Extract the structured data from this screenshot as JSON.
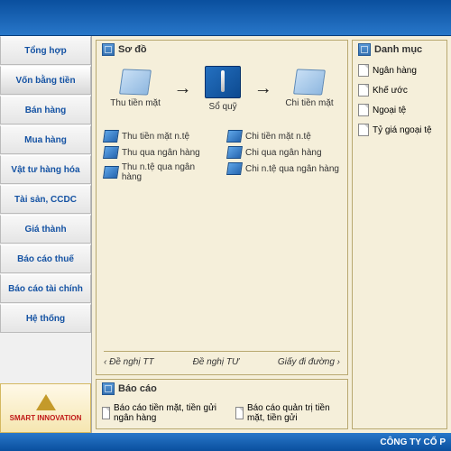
{
  "sidebar": {
    "items": [
      {
        "label": "Tổng hợp"
      },
      {
        "label": "Vốn bằng tiền"
      },
      {
        "label": "Bán hàng"
      },
      {
        "label": "Mua hàng"
      },
      {
        "label": "Vật tư hàng hóa"
      },
      {
        "label": "Tài sản, CCDC"
      },
      {
        "label": "Giá thành"
      },
      {
        "label": "Báo cáo thuế"
      },
      {
        "label": "Báo cáo tài chính"
      },
      {
        "label": "Hệ thống"
      }
    ],
    "active_index": 1,
    "brand": "SMART INNOVATION"
  },
  "schema": {
    "title": "Sơ đồ",
    "flow": {
      "left": "Thu tiền mặt",
      "center": "Sổ quỹ",
      "right": "Chi tiền mặt"
    },
    "actions_left": [
      "Thu tiền mặt n.tệ",
      "Thu qua ngân hàng",
      "Thu n.tệ qua ngân hàng"
    ],
    "actions_right": [
      "Chi tiền mặt n.tệ",
      "Chi qua ngân hàng",
      "Chi n.tệ qua ngân hàng"
    ],
    "footer": {
      "left": "‹ Đề nghị TT",
      "center": "Đề nghị TƯ",
      "right": "Giấy đi đường ›"
    }
  },
  "report": {
    "title": "Báo cáo",
    "items": [
      "Báo cáo tiền mặt, tiền gửi ngân hàng",
      "Báo cáo quản trị tiền mặt, tiền gửi"
    ]
  },
  "catalog": {
    "title": "Danh mục",
    "items": [
      "Ngân hàng",
      "Khế ước",
      "Ngoại tệ",
      "Tỷ giá ngoại tệ"
    ]
  },
  "footer_text": "CÔNG TY CỔ P"
}
